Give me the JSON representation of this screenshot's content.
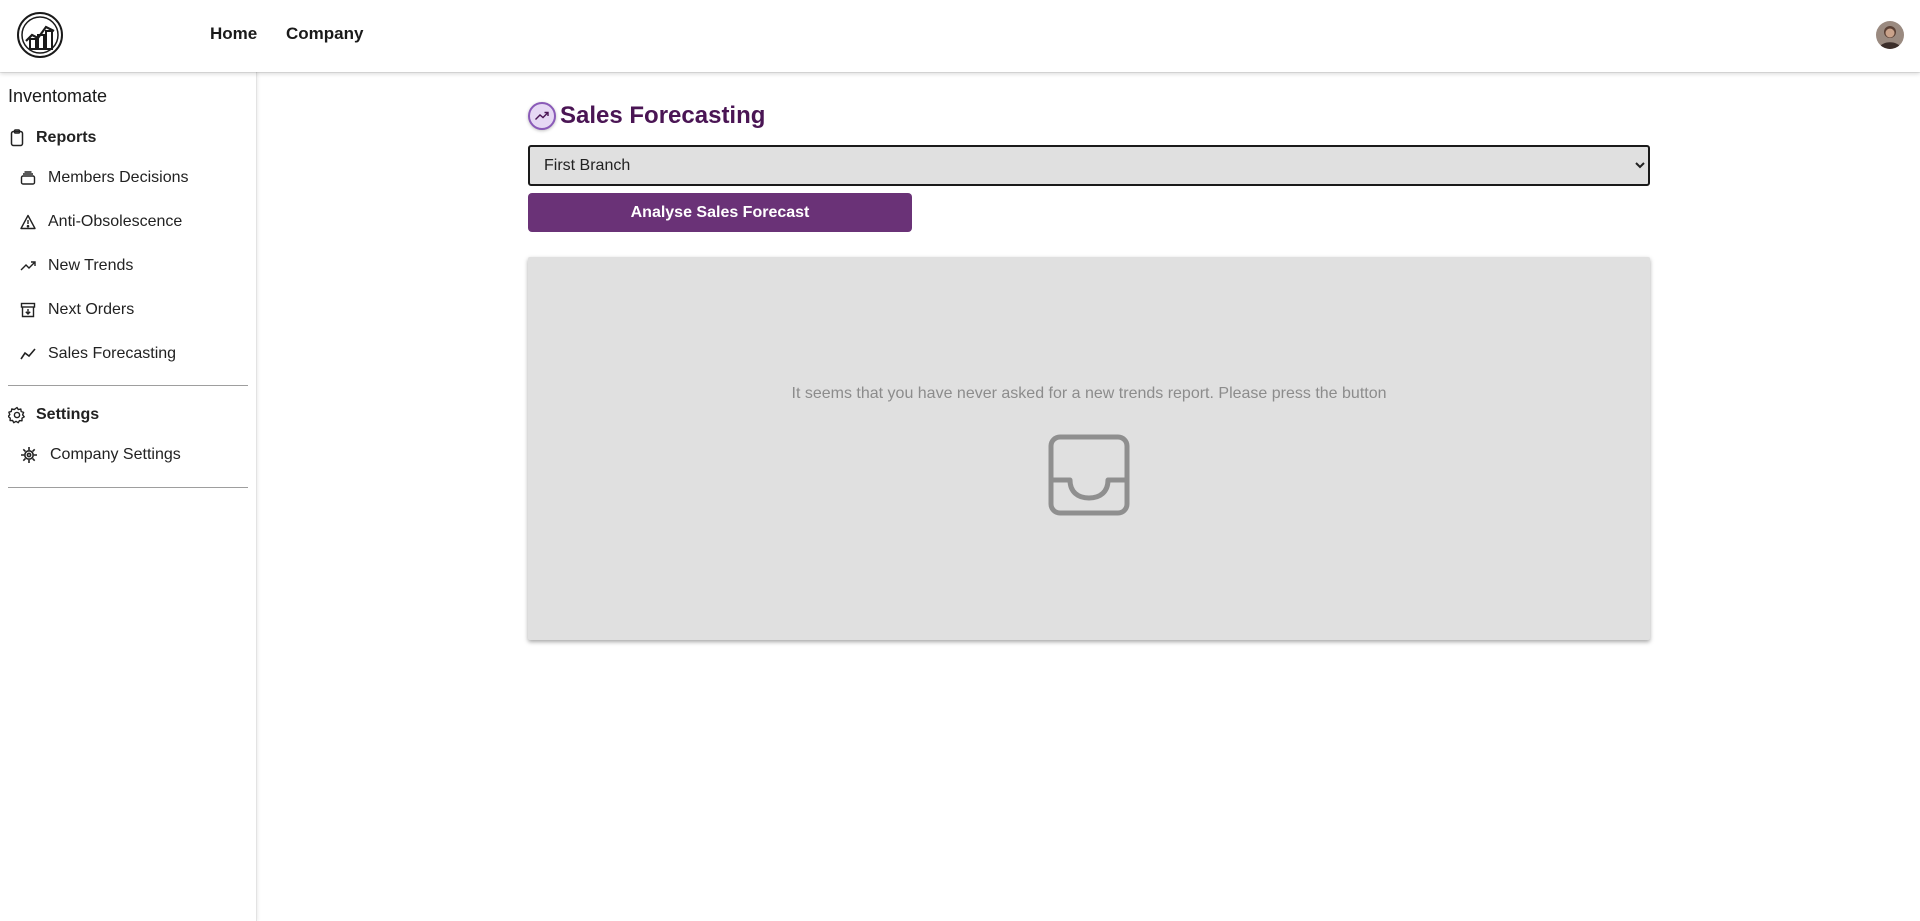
{
  "header": {
    "logo_icon": "building-chart-logo-icon",
    "nav": {
      "home_label": "Home",
      "company_label": "Company"
    },
    "avatar_icon": "user-avatar"
  },
  "sidebar": {
    "app_name": "Inventomate",
    "reports": {
      "label": "Reports",
      "icon": "clipboard-icon",
      "items": [
        {
          "label": "Members Decisions",
          "icon": "stack-icon"
        },
        {
          "label": "Anti-Obsolescence",
          "icon": "warning-triangle-icon"
        },
        {
          "label": "New Trends",
          "icon": "trending-up-icon"
        },
        {
          "label": "Next Orders",
          "icon": "archive-down-icon"
        },
        {
          "label": "Sales Forecasting",
          "icon": "line-chart-icon"
        }
      ]
    },
    "settings": {
      "label": "Settings",
      "icon": "gear-icon",
      "items": [
        {
          "label": "Company Settings",
          "icon": "cog-icon"
        }
      ]
    }
  },
  "main": {
    "title": "Sales Forecasting",
    "title_icon": "trending-up-icon",
    "branch_select": {
      "selected": "First Branch"
    },
    "analyse_button_label": "Analyse Sales Forecast",
    "empty_state": {
      "message": "It seems that you have never asked for a new trends report. Please press the button",
      "icon": "inbox-icon"
    }
  },
  "colors": {
    "accent": "#6a3277",
    "title": "#4a1554",
    "panel_bg": "#e0e0e0",
    "muted_text": "#8c8c8c"
  }
}
